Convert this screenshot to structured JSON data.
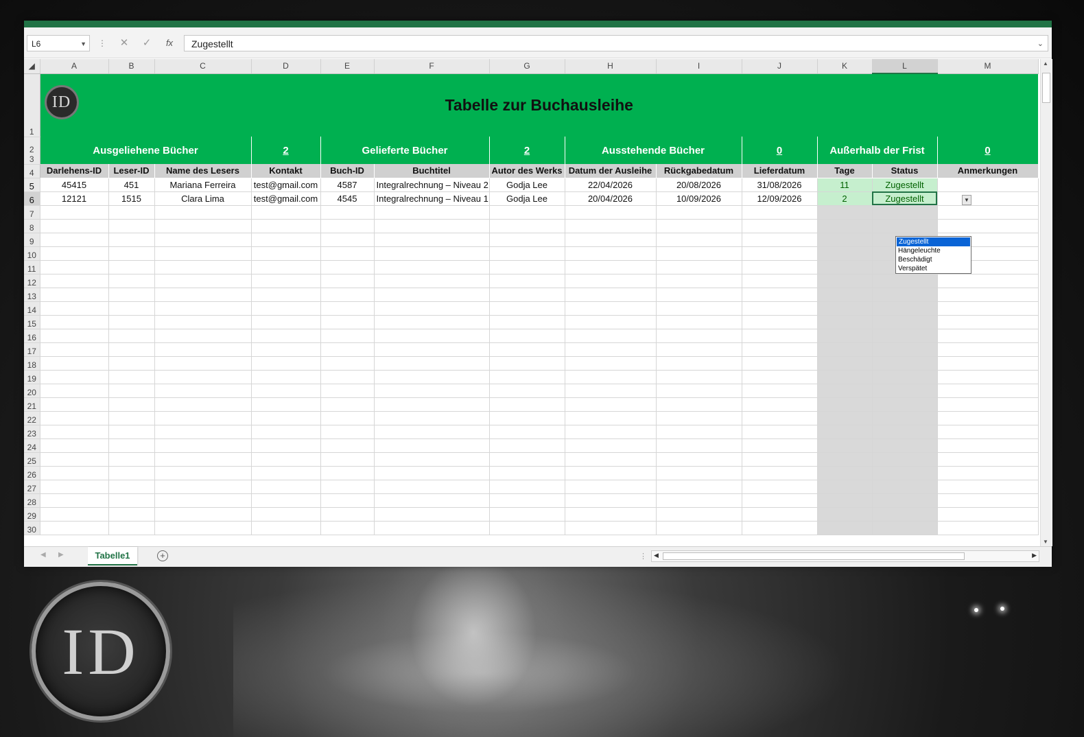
{
  "window": {
    "name_box": "L6",
    "formula_value": "Zugestellt",
    "fx_label": "fx"
  },
  "columns": [
    "A",
    "B",
    "C",
    "D",
    "E",
    "F",
    "G",
    "H",
    "I",
    "J",
    "K",
    "L",
    "M"
  ],
  "title": "Tabelle zur Buchausleihe",
  "logo_text": "ID",
  "summary": [
    {
      "label": "Ausgeliehene Bücher",
      "value": "2"
    },
    {
      "label": "Gelieferte Bücher",
      "value": "2"
    },
    {
      "label": "Ausstehende Bücher",
      "value": "0"
    },
    {
      "label": "Außerhalb der Frist",
      "value": "0"
    }
  ],
  "headers": [
    "Darlehens-ID",
    "Leser-ID",
    "Name des Lesers",
    "Kontakt",
    "Buch-ID",
    "Buchtitel",
    "Autor des Werks",
    "Datum der Ausleihe",
    "Rückgabedatum",
    "Lieferdatum",
    "Tage",
    "Status",
    "Anmerkungen"
  ],
  "rows": [
    [
      "45415",
      "451",
      "Mariana Ferreira",
      "test@gmail.com",
      "4587",
      "Integralrechnung – Niveau 2",
      "Godja Lee",
      "22/04/2026",
      "20/08/2026",
      "31/08/2026",
      "11",
      "Zugestellt",
      ""
    ],
    [
      "12121",
      "1515",
      "Clara Lima",
      "test@gmail.com",
      "4545",
      "Integralrechnung – Niveau 1",
      "Godja Lee",
      "20/04/2026",
      "10/09/2026",
      "12/09/2026",
      "2",
      "Zugestellt",
      ""
    ]
  ],
  "row_numbers": [
    "1",
    "2",
    "3",
    "4",
    "5",
    "6",
    "7",
    "8",
    "9",
    "10",
    "11",
    "12",
    "13",
    "14",
    "15",
    "16",
    "17",
    "18",
    "19",
    "20",
    "21",
    "22",
    "23",
    "24",
    "25",
    "26",
    "27",
    "28",
    "29",
    "30"
  ],
  "dropdown_options": [
    "Zugestellt",
    "Hängeleuchte",
    "Beschädigt",
    "Verspätet"
  ],
  "sheet_tab": "Tabelle1",
  "colors": {
    "accent_green": "#00b050",
    "excel_green": "#217346",
    "status_fill": "#c6efce"
  }
}
